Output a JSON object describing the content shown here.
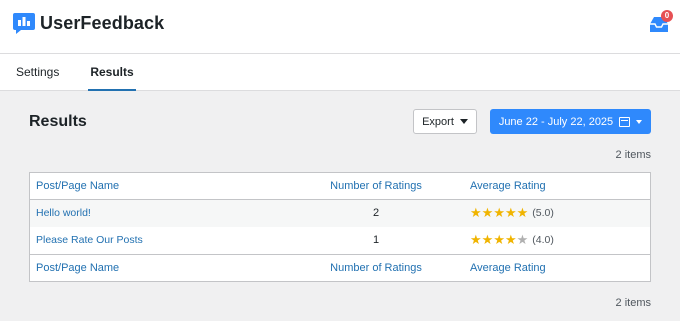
{
  "header": {
    "brand": "UserFeedback",
    "notification_count": "0",
    "colors": {
      "accent": "#2f89fc",
      "badge": "#e65054"
    }
  },
  "tabs": [
    {
      "label": "Settings",
      "active": false
    },
    {
      "label": "Results",
      "active": true
    }
  ],
  "main": {
    "title": "Results",
    "export_label": "Export",
    "date_range_label": "June 22 - July 22, 2025",
    "items_count_top": "2 items",
    "items_count_bottom": "2 items"
  },
  "table": {
    "columns": [
      "Post/Page Name",
      "Number of Ratings",
      "Average Rating"
    ],
    "rows": [
      {
        "name": "Hello world!",
        "ratings": "2",
        "stars": 5,
        "average": "(5.0)"
      },
      {
        "name": "Please Rate Our Posts",
        "ratings": "1",
        "stars": 4,
        "average": "(4.0)"
      }
    ]
  }
}
